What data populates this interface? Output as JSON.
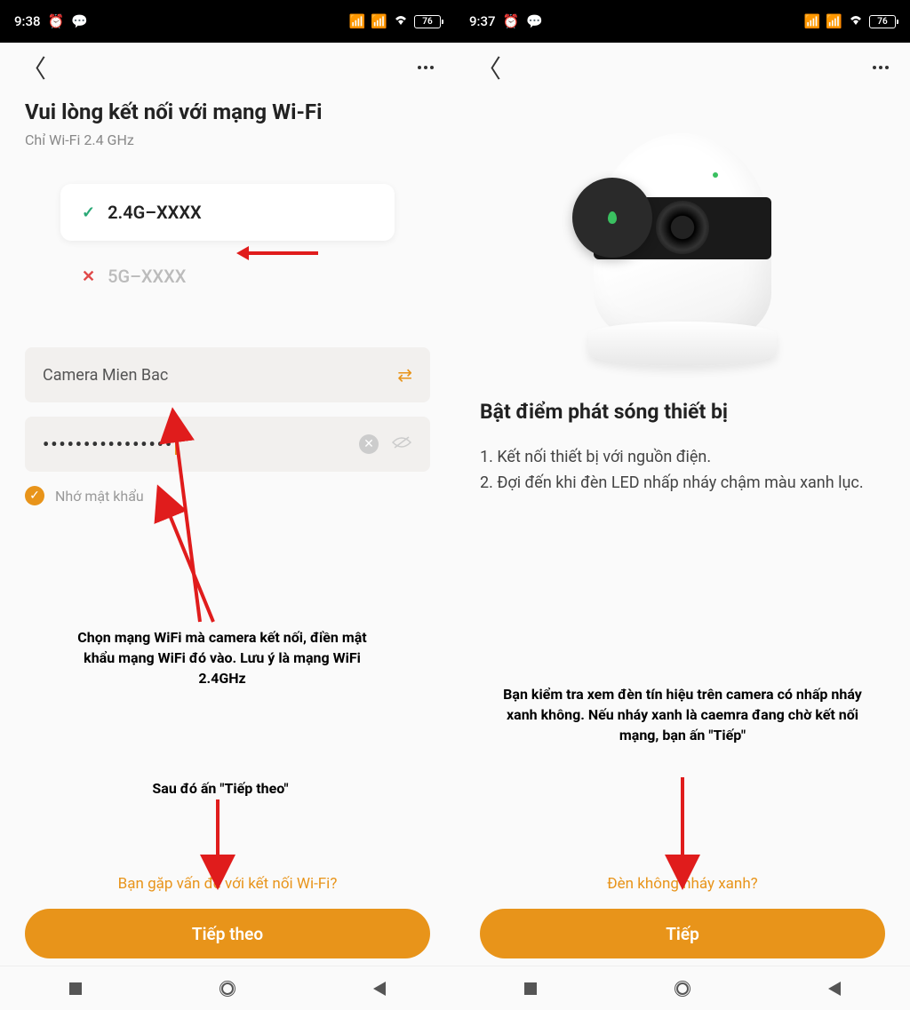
{
  "left": {
    "status": {
      "time": "9:38",
      "battery": "76"
    },
    "title": "Vui lòng kết nối với mạng Wi-Fi",
    "subtitle": "Chỉ Wi-Fi 2.4 GHz",
    "wifi_ok": "2.4G–XXXX",
    "wifi_bad": "5G–XXXX",
    "ssid_value": "Camera Mien Bac",
    "password_mask": "••••••••••••••••",
    "remember_label": "Nhớ mật khẩu",
    "help_link": "Bạn gặp vấn đề với kết nối Wi-Fi?",
    "primary_button": "Tiếp theo",
    "annot_wifi": "Chọn mạng WiFi mà camera kết nối, điền mật khẩu mạng WiFi đó vào. Lưu ý là mạng WiFi 2.4GHz",
    "annot_next": "Sau đó ấn \"Tiếp theo\""
  },
  "right": {
    "status": {
      "time": "9:37",
      "battery": "76"
    },
    "title": "Bật điểm phát sóng thiết bị",
    "step1": "1. Kết nối thiết bị với nguồn điện.",
    "step2": "2. Đợi đến khi đèn LED nhấp nháy chậm màu xanh lục.",
    "help_link": "Đèn không nháy xanh?",
    "primary_button": "Tiếp",
    "annot_check": "Bạn kiểm tra xem đèn tín hiệu trên camera có nhấp nháy xanh không. Nếu nháy xanh là caemra đang chờ kết nối mạng, bạn ấn \"Tiếp\""
  },
  "icons": {
    "check": "✓",
    "cross": "✕",
    "swap": "⇄",
    "clear": "✕",
    "eye": "👁"
  }
}
